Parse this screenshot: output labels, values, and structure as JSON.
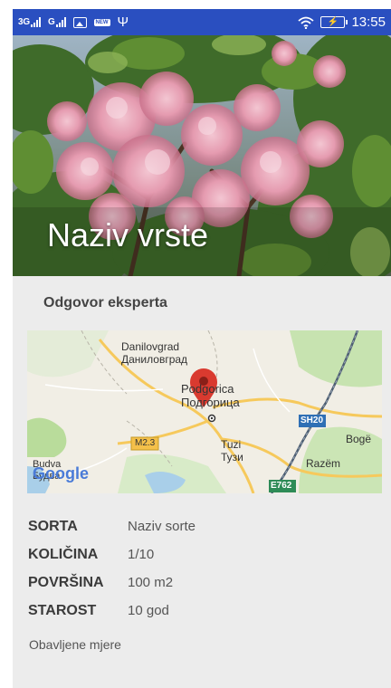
{
  "status_bar": {
    "sim1": "3G",
    "sim2": "G",
    "new_badge": "NEW",
    "time": "13:55"
  },
  "hero": {
    "title": "Naziv vrste"
  },
  "card": {
    "label": "Odgovor eksperta"
  },
  "map": {
    "labels": {
      "danilovgrad_lat": "Danilovgrad",
      "danilovgrad_cyr": "Даниловград",
      "podgorica_lat": "Podgorica",
      "podgorica_cyr": "Подгорица",
      "tuzi_lat": "Tuzi",
      "tuzi_cyr": "Тузи",
      "boge": "Bogë",
      "razem": "Razëm",
      "budva_lat": "Budva",
      "budva_cyr": "Будва",
      "road_m23": "M2.3",
      "road_sh20": "SH20",
      "road_e762": "E762",
      "google": "Google"
    }
  },
  "info": {
    "rows": [
      {
        "key": "SORTA",
        "value": "Naziv sorte"
      },
      {
        "key": "KOLIČINA",
        "value": "1/10"
      },
      {
        "key": "POVRŠINA",
        "value": "100 m2"
      },
      {
        "key": "STAROST",
        "value": "10 god"
      }
    ]
  },
  "measures": {
    "label": "Obavljene mjere"
  },
  "colors": {
    "status_bar": "#2a4fc0",
    "background": "#ececec",
    "map_pin": "#d93a2f"
  }
}
